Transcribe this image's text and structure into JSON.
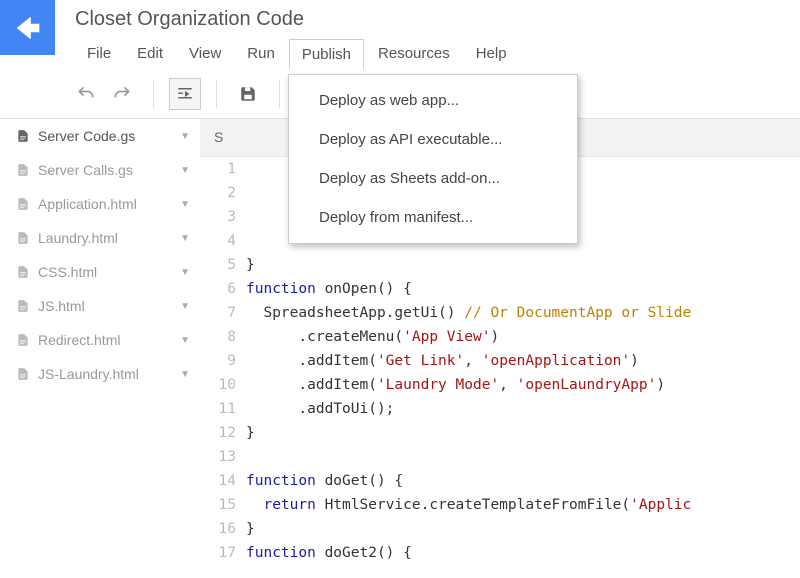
{
  "project": {
    "title": "Closet Organization Code"
  },
  "menubar": [
    "File",
    "Edit",
    "View",
    "Run",
    "Publish",
    "Resources",
    "Help"
  ],
  "menubar_active_index": 4,
  "dropdown": {
    "items": [
      "Deploy as web app...",
      "Deploy as API executable...",
      "Deploy as Sheets add-on...",
      "Deploy from manifest..."
    ]
  },
  "files": [
    {
      "name": "Server Code.gs",
      "active": true
    },
    {
      "name": "Server Calls.gs",
      "active": false
    },
    {
      "name": "Application.html",
      "active": false
    },
    {
      "name": "Laundry.html",
      "active": false
    },
    {
      "name": "CSS.html",
      "active": false
    },
    {
      "name": "JS.html",
      "active": false
    },
    {
      "name": "Redirect.html",
      "active": false
    },
    {
      "name": "JS-Laundry.html",
      "active": false
    }
  ],
  "breadcrumb": {
    "text": "S"
  },
  "code": {
    "start_line": 1,
    "lines": [
      {
        "n": 1,
        "html": ""
      },
      {
        "n": 2,
        "html": ""
      },
      {
        "n": 3,
        "html": ""
      },
      {
        "n": 4,
        "html": ""
      },
      {
        "n": 5,
        "html": "}"
      },
      {
        "n": 6,
        "html": "<span class=\"k\">function</span> onOpen() {"
      },
      {
        "n": 7,
        "html": "  SpreadsheetApp.getUi() <span class=\"c\">// Or DocumentApp or Slide</span>"
      },
      {
        "n": 8,
        "html": "      .createMenu(<span class=\"s\">'App View'</span>)"
      },
      {
        "n": 9,
        "html": "      .addItem(<span class=\"s\">'Get Link'</span>, <span class=\"s\">'openApplication'</span>)"
      },
      {
        "n": 10,
        "html": "      .addItem(<span class=\"s\">'Laundry Mode'</span>, <span class=\"s\">'openLaundryApp'</span>)"
      },
      {
        "n": 11,
        "html": "      .addToUi();"
      },
      {
        "n": 12,
        "html": "}"
      },
      {
        "n": 13,
        "html": ""
      },
      {
        "n": 14,
        "html": "<span class=\"k\">function</span> doGet() {"
      },
      {
        "n": 15,
        "html": "  <span class=\"k\">return</span> HtmlService.createTemplateFromFile(<span class=\"s\">'Applic</span>"
      },
      {
        "n": 16,
        "html": "}"
      },
      {
        "n": 17,
        "html": "<span class=\"k\">function</span> doGet2() {"
      }
    ]
  }
}
